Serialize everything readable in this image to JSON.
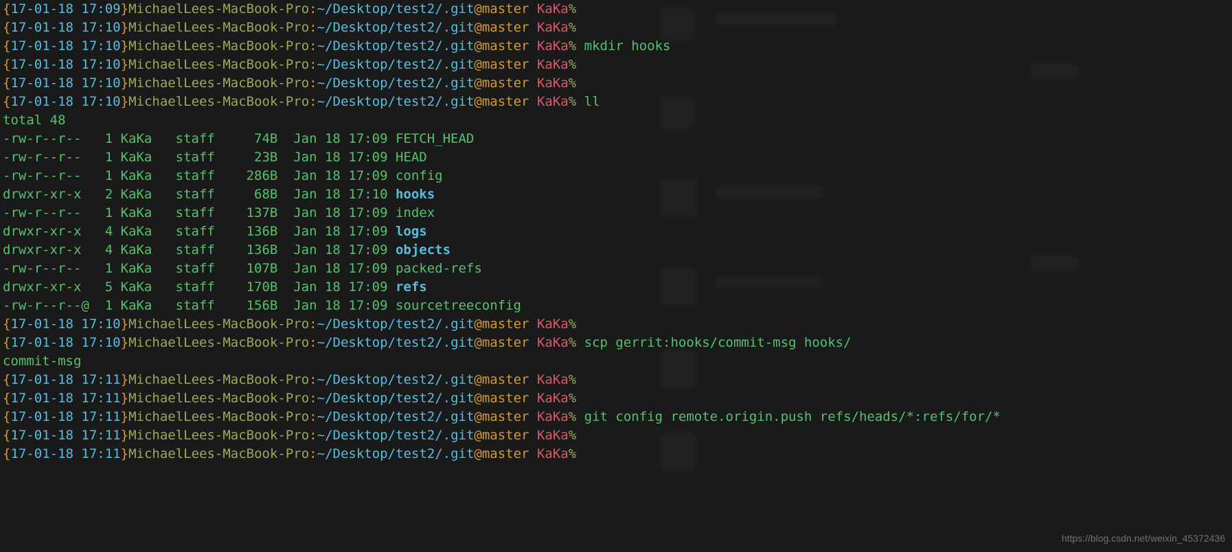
{
  "watermark": "https://blog.csdn.net/weixin_45372436",
  "host": "MichaelLees-MacBook-Pro",
  "path": "~/Desktop/test2/.git",
  "branch": "master",
  "user_name": "KaKa",
  "prompts": [
    {
      "time": "17-01-18 17:09",
      "command": ""
    },
    {
      "time": "17-01-18 17:10",
      "command": ""
    },
    {
      "time": "17-01-18 17:10",
      "command": "mkdir hooks"
    },
    {
      "time": "17-01-18 17:10",
      "command": ""
    },
    {
      "time": "17-01-18 17:10",
      "command": ""
    },
    {
      "time": "17-01-18 17:10",
      "command": "ll"
    }
  ],
  "listing_total_label": "total",
  "listing_total": "48",
  "listing": [
    {
      "perm": "-rw-r--r--",
      "links": "1",
      "owner": "KaKa",
      "group": "staff",
      "size": "74B",
      "date": "Jan 18 17:09",
      "name": "FETCH_HEAD",
      "is_dir": false
    },
    {
      "perm": "-rw-r--r--",
      "links": "1",
      "owner": "KaKa",
      "group": "staff",
      "size": "23B",
      "date": "Jan 18 17:09",
      "name": "HEAD",
      "is_dir": false
    },
    {
      "perm": "-rw-r--r--",
      "links": "1",
      "owner": "KaKa",
      "group": "staff",
      "size": "286B",
      "date": "Jan 18 17:09",
      "name": "config",
      "is_dir": false
    },
    {
      "perm": "drwxr-xr-x",
      "links": "2",
      "owner": "KaKa",
      "group": "staff",
      "size": "68B",
      "date": "Jan 18 17:10",
      "name": "hooks",
      "is_dir": true
    },
    {
      "perm": "-rw-r--r--",
      "links": "1",
      "owner": "KaKa",
      "group": "staff",
      "size": "137B",
      "date": "Jan 18 17:09",
      "name": "index",
      "is_dir": false
    },
    {
      "perm": "drwxr-xr-x",
      "links": "4",
      "owner": "KaKa",
      "group": "staff",
      "size": "136B",
      "date": "Jan 18 17:09",
      "name": "logs",
      "is_dir": true
    },
    {
      "perm": "drwxr-xr-x",
      "links": "4",
      "owner": "KaKa",
      "group": "staff",
      "size": "136B",
      "date": "Jan 18 17:09",
      "name": "objects",
      "is_dir": true
    },
    {
      "perm": "-rw-r--r--",
      "links": "1",
      "owner": "KaKa",
      "group": "staff",
      "size": "107B",
      "date": "Jan 18 17:09",
      "name": "packed-refs",
      "is_dir": false
    },
    {
      "perm": "drwxr-xr-x",
      "links": "5",
      "owner": "KaKa",
      "group": "staff",
      "size": "170B",
      "date": "Jan 18 17:09",
      "name": "refs",
      "is_dir": true
    },
    {
      "perm": "-rw-r--r--@",
      "links": "1",
      "owner": "KaKa",
      "group": "staff",
      "size": "156B",
      "date": "Jan 18 17:09",
      "name": "sourcetreeconfig",
      "is_dir": false
    }
  ],
  "prompts2": [
    {
      "time": "17-01-18 17:10",
      "command": ""
    },
    {
      "time": "17-01-18 17:10",
      "command": "scp gerrit:hooks/commit-msg hooks/"
    }
  ],
  "scp_output": "commit-msg",
  "prompts3": [
    {
      "time": "17-01-18 17:11",
      "command": ""
    },
    {
      "time": "17-01-18 17:11",
      "command": ""
    },
    {
      "time": "17-01-18 17:11",
      "command": "git config remote.origin.push refs/heads/*:refs/for/*"
    },
    {
      "time": "17-01-18 17:11",
      "command": ""
    },
    {
      "time": "17-01-18 17:11",
      "command": ""
    }
  ]
}
